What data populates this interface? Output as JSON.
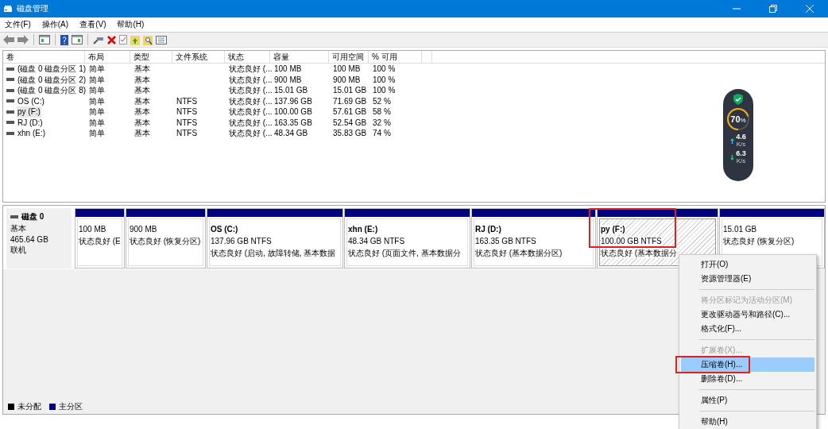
{
  "window": {
    "title": "磁盘管理"
  },
  "menu": [
    "文件(F)",
    "操作(A)",
    "查看(V)",
    "帮助(H)"
  ],
  "table": {
    "columns": [
      "卷",
      "布局",
      "类型",
      "文件系统",
      "状态",
      "容量",
      "可用空间",
      "% 可用"
    ],
    "rows": [
      {
        "cells": [
          "(磁盘 0 磁盘分区 1)",
          "简单",
          "基本",
          "",
          "状态良好 (...",
          "100 MB",
          "100 MB",
          "100 %"
        ],
        "selected": false
      },
      {
        "cells": [
          "(磁盘 0 磁盘分区 2)",
          "简单",
          "基本",
          "",
          "状态良好 (...",
          "900 MB",
          "900 MB",
          "100 %"
        ],
        "selected": false
      },
      {
        "cells": [
          "(磁盘 0 磁盘分区 8)",
          "简单",
          "基本",
          "",
          "状态良好 (...",
          "15.01 GB",
          "15.01 GB",
          "100 %"
        ],
        "selected": false
      },
      {
        "cells": [
          "OS (C:)",
          "简单",
          "基本",
          "NTFS",
          "状态良好 (...",
          "137.96 GB",
          "71.69 GB",
          "52 %"
        ],
        "selected": false
      },
      {
        "cells": [
          "py (F:)",
          "简单",
          "基本",
          "NTFS",
          "状态良好 (...",
          "100.00 GB",
          "57.61 GB",
          "58 %"
        ],
        "selected": true
      },
      {
        "cells": [
          "RJ (D:)",
          "简单",
          "基本",
          "NTFS",
          "状态良好 (...",
          "163.35 GB",
          "52.54 GB",
          "32 %"
        ],
        "selected": false
      },
      {
        "cells": [
          "xhn (E:)",
          "简单",
          "基本",
          "NTFS",
          "状态良好 (...",
          "48.34 GB",
          "35.83 GB",
          "74 %"
        ],
        "selected": false
      }
    ]
  },
  "speed_widget": {
    "percent": "70",
    "unit": "%",
    "level": 0.7,
    "upload": "4.6",
    "upload_unit": "K/s",
    "download": "6.3",
    "download_unit": "K/s"
  },
  "disk": {
    "name": "磁盘 0",
    "type": "基本",
    "size": "465.64 GB",
    "status": "联机",
    "partitions": [
      {
        "size": "100 MB",
        "status": "状态良好 (E",
        "selected": false,
        "highlighted": false
      },
      {
        "size": "900 MB",
        "status": "状态良好 (恢复分区)",
        "selected": false,
        "highlighted": false
      },
      {
        "name": "OS  (C:)",
        "size": "137.96 GB NTFS",
        "status": "状态良好 (启动, 故障转储, 基本数据",
        "selected": false,
        "highlighted": false
      },
      {
        "name": "xhn  (E:)",
        "size": "48.34 GB NTFS",
        "status": "状态良好 (页面文件, 基本数据分",
        "selected": false,
        "highlighted": false
      },
      {
        "name": "RJ  (D:)",
        "size": "163.35 GB NTFS",
        "status": "状态良好 (基本数据分区)",
        "selected": false,
        "highlighted": false
      },
      {
        "name": "py  (F:)",
        "size": "100.00 GB NTFS",
        "status": "状态良好 (基本数据分",
        "selected": true,
        "highlighted": true
      },
      {
        "size": "15.01 GB",
        "status": "状态良好 (恢复分区)",
        "selected": false,
        "highlighted": false
      }
    ]
  },
  "context_menu": [
    {
      "kind": "item",
      "label": "打开(O)",
      "disabled": false,
      "selected": false,
      "highlighted": false
    },
    {
      "kind": "item",
      "label": "资源管理器(E)",
      "disabled": false,
      "selected": false,
      "highlighted": false
    },
    {
      "kind": "separator"
    },
    {
      "kind": "item",
      "label": "将分区标记为活动分区(M)",
      "disabled": true,
      "selected": false,
      "highlighted": false
    },
    {
      "kind": "item",
      "label": "更改驱动器号和路径(C)...",
      "disabled": false,
      "selected": false,
      "highlighted": false
    },
    {
      "kind": "item",
      "label": "格式化(F)...",
      "disabled": false,
      "selected": false,
      "highlighted": false
    },
    {
      "kind": "separator"
    },
    {
      "kind": "item",
      "label": "扩展卷(X)...",
      "disabled": true,
      "selected": false,
      "highlighted": false
    },
    {
      "kind": "item",
      "label": "压缩卷(H)...",
      "disabled": false,
      "selected": true,
      "highlighted": true
    },
    {
      "kind": "item",
      "label": "删除卷(D)...",
      "disabled": false,
      "selected": false,
      "highlighted": false
    },
    {
      "kind": "separator"
    },
    {
      "kind": "item",
      "label": "属性(P)",
      "disabled": false,
      "selected": false,
      "highlighted": false
    },
    {
      "kind": "separator"
    },
    {
      "kind": "item",
      "label": "帮助(H)",
      "disabled": false,
      "selected": false,
      "highlighted": false
    }
  ],
  "legend": [
    {
      "label": "未分配",
      "color": "#000000"
    },
    {
      "label": "主分区",
      "color": "#000080"
    }
  ]
}
